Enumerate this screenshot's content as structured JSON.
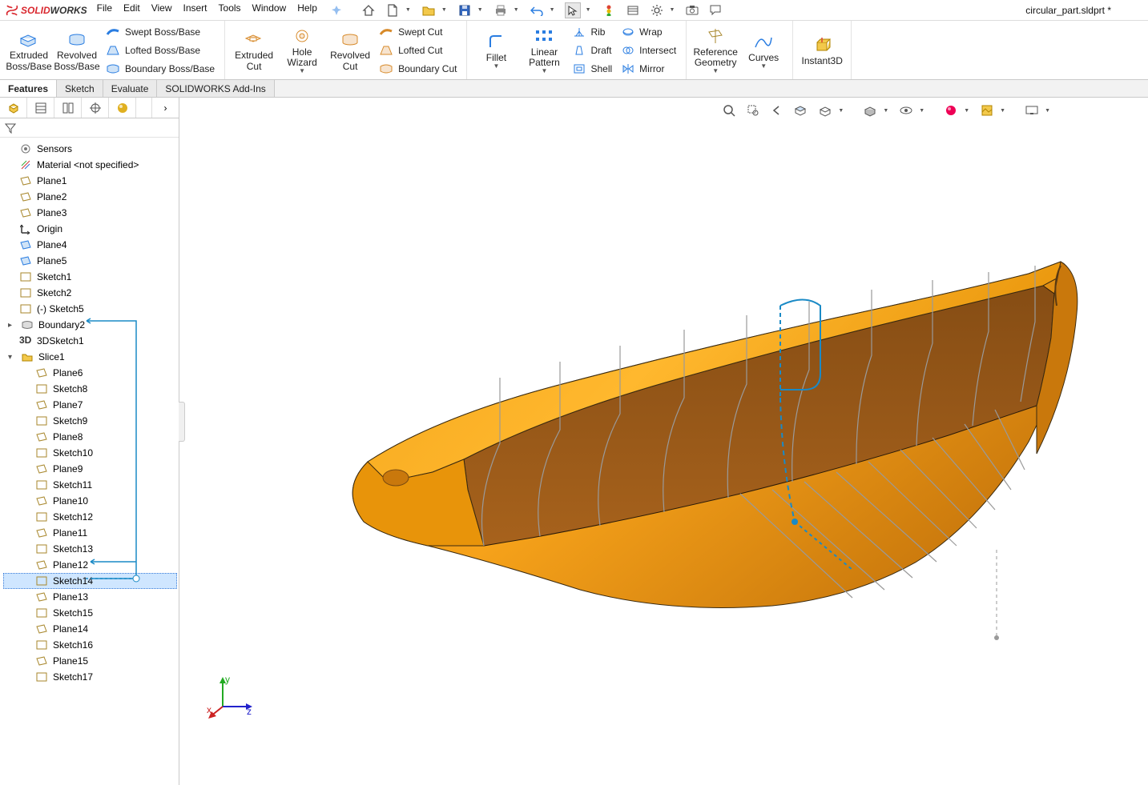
{
  "app": {
    "brand_ds": "S",
    "brand_solid": "SOLID",
    "brand_works": "WORKS",
    "doc_title": "circular_part.sldprt *"
  },
  "menu": {
    "file": "File",
    "edit": "Edit",
    "view": "View",
    "insert": "Insert",
    "tools": "Tools",
    "window": "Window",
    "help": "Help"
  },
  "ribbon": {
    "extruded_boss": "Extruded\nBoss/Base",
    "revolved_boss": "Revolved\nBoss/Base",
    "swept_boss": "Swept Boss/Base",
    "lofted_boss": "Lofted Boss/Base",
    "boundary_boss": "Boundary Boss/Base",
    "extruded_cut": "Extruded\nCut",
    "hole_wizard": "Hole\nWizard",
    "revolved_cut": "Revolved\nCut",
    "swept_cut": "Swept Cut",
    "lofted_cut": "Lofted Cut",
    "boundary_cut": "Boundary Cut",
    "fillet": "Fillet",
    "linear_pattern": "Linear\nPattern",
    "rib": "Rib",
    "draft": "Draft",
    "shell": "Shell",
    "wrap": "Wrap",
    "intersect": "Intersect",
    "mirror": "Mirror",
    "ref_geometry": "Reference\nGeometry",
    "curves": "Curves",
    "instant3d": "Instant3D"
  },
  "subtabs": {
    "features": "Features",
    "sketch": "Sketch",
    "evaluate": "Evaluate",
    "addins": "SOLIDWORKS Add-Ins"
  },
  "tree": {
    "sensors": "Sensors",
    "material": "Material <not specified>",
    "plane1": "Plane1",
    "plane2": "Plane2",
    "plane3": "Plane3",
    "origin": "Origin",
    "plane4": "Plane4",
    "plane5": "Plane5",
    "sketch1": "Sketch1",
    "sketch2": "Sketch2",
    "sketch5": "(-) Sketch5",
    "boundary2": "Boundary2",
    "3dsketch1": "3DSketch1",
    "slice1": "Slice1",
    "plane6": "Plane6",
    "sketch8": "Sketch8",
    "plane7": "Plane7",
    "sketch9": "Sketch9",
    "plane8": "Plane8",
    "sketch10": "Sketch10",
    "plane9": "Plane9",
    "sketch11": "Sketch11",
    "plane10": "Plane10",
    "sketch12": "Sketch12",
    "plane11": "Plane11",
    "sketch13": "Sketch13",
    "plane12": "Plane12",
    "sketch14": "Sketch14",
    "plane13": "Plane13",
    "sketch15": "Sketch15",
    "plane14": "Plane14",
    "sketch16": "Sketch16",
    "plane15": "Plane15",
    "sketch17": "Sketch17"
  },
  "triad": {
    "x": "x",
    "y": "y",
    "z": "z"
  }
}
